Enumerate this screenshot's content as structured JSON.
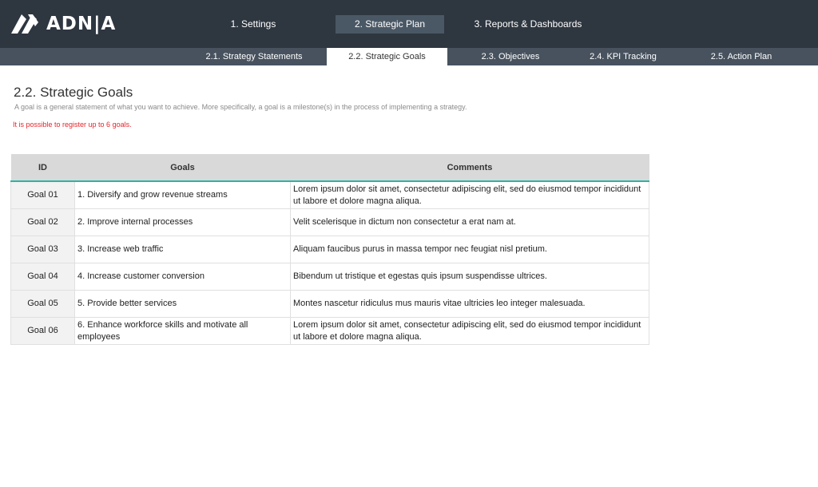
{
  "app": {
    "logo_text": "ADN|A"
  },
  "main_nav": [
    {
      "label": "1. Settings",
      "active": false
    },
    {
      "label": "2. Strategic Plan",
      "active": true
    },
    {
      "label": "3. Reports & Dashboards",
      "active": false
    }
  ],
  "sub_nav": [
    {
      "label": "2.1. Strategy Statements",
      "active": false
    },
    {
      "label": "2.2. Strategic Goals",
      "active": true
    },
    {
      "label": "2.3. Objectives",
      "active": false
    },
    {
      "label": "2.4. KPI Tracking",
      "active": false
    },
    {
      "label": "2.5. Action Plan",
      "active": false
    }
  ],
  "page": {
    "title": "2.2. Strategic Goals",
    "description": "A goal is a general statement of what you want to achieve. More specifically, a goal is a milestone(s) in the process of implementing a strategy.",
    "note": "It is possible to register up to 6 goals."
  },
  "table": {
    "headers": {
      "id": "ID",
      "goals": "Goals",
      "comments": "Comments"
    },
    "rows": [
      {
        "id": "Goal 01",
        "goal": "1. Diversify and grow revenue streams",
        "comment": "Lorem ipsum dolor sit amet, consectetur adipiscing elit, sed do eiusmod tempor incididunt ut labore et dolore magna aliqua."
      },
      {
        "id": "Goal 02",
        "goal": "2. Improve internal processes",
        "comment": "Velit scelerisque in dictum non consectetur a erat nam at."
      },
      {
        "id": "Goal 03",
        "goal": "3. Increase web traffic",
        "comment": "Aliquam faucibus purus in massa tempor nec feugiat nisl pretium."
      },
      {
        "id": "Goal 04",
        "goal": "4. Increase customer conversion",
        "comment": "Bibendum ut tristique et egestas quis ipsum suspendisse ultrices."
      },
      {
        "id": "Goal 05",
        "goal": "5. Provide better services",
        "comment": "Montes nascetur ridiculus mus mauris vitae ultricies leo integer malesuada."
      },
      {
        "id": "Goal 06",
        "goal": "6. Enhance workforce skills and motivate all employees",
        "comment": "Lorem ipsum dolor sit amet, consectetur adipiscing elit, sed do eiusmod tempor incididunt ut labore et dolore magna aliqua."
      }
    ]
  },
  "colors": {
    "topbar": "#2e3640",
    "subbar": "#47525e",
    "accent": "#2ab5a5",
    "note": "#e8242a"
  }
}
